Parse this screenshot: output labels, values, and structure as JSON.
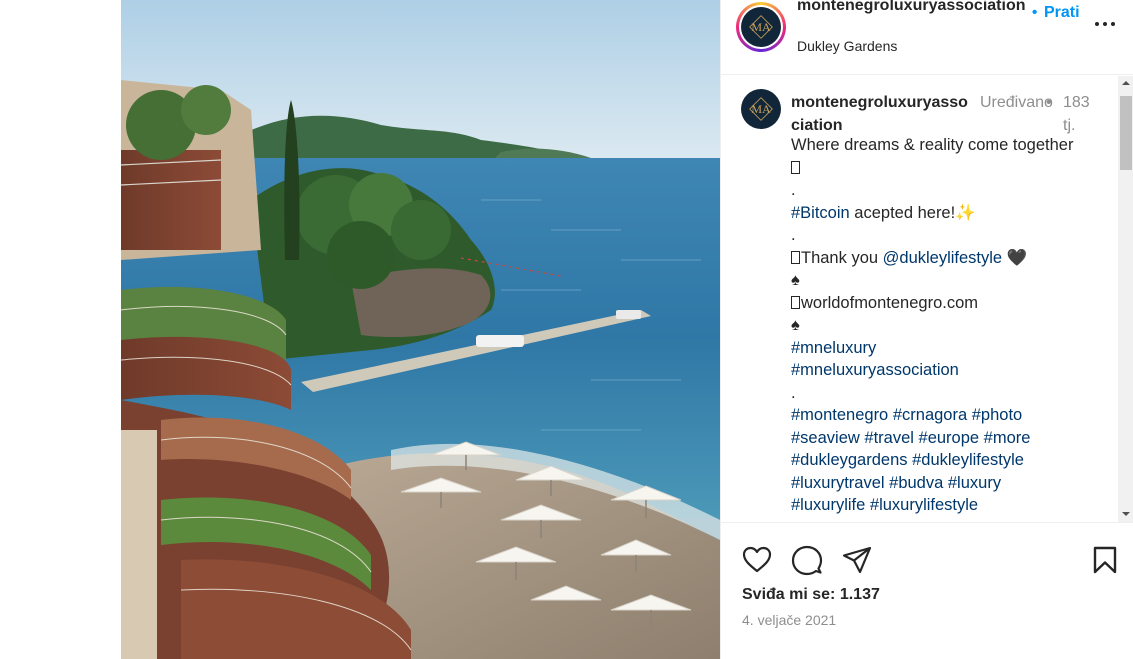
{
  "post": {
    "username_header": "montenegroluxuryassociation",
    "follow_dot": "•",
    "follow_label": "Prati",
    "location": "Dukley Gardens",
    "avatar_monogram": "MA"
  },
  "caption": {
    "username": "montenegroluxuryassociation",
    "edited_label": "Uređivano",
    "bullet": "•",
    "age": "183 tj.",
    "lines": [
      [
        {
          "t": "Where dreams & reality come together"
        }
      ],
      [
        {
          "t": "",
          "tofu": true
        }
      ],
      [
        {
          "t": "."
        }
      ],
      [
        {
          "t": "#Bitcoin",
          "tag": true
        },
        {
          "t": " acepted here!✨"
        }
      ],
      [
        {
          "t": "."
        }
      ],
      [
        {
          "t": "",
          "tofu": true
        },
        {
          "t": "Thank you "
        },
        {
          "t": "@dukleylifestyle",
          "tag": true
        },
        {
          "t": " 🖤"
        }
      ],
      [
        {
          "t": "♠"
        }
      ],
      [
        {
          "t": "",
          "tofu": true
        },
        {
          "t": "worldofmontenegro.com"
        }
      ],
      [
        {
          "t": "♠"
        }
      ],
      [
        {
          "t": "#mneluxury",
          "tag": true
        }
      ],
      [
        {
          "t": "#mneluxuryassociation",
          "tag": true
        }
      ],
      [
        {
          "t": "."
        }
      ],
      [
        {
          "t": "#montenegro",
          "tag": true
        },
        {
          "t": " "
        },
        {
          "t": "#crnagora",
          "tag": true
        },
        {
          "t": " "
        },
        {
          "t": "#photo",
          "tag": true
        }
      ],
      [
        {
          "t": "#seaview",
          "tag": true
        },
        {
          "t": " "
        },
        {
          "t": "#travel",
          "tag": true
        },
        {
          "t": " "
        },
        {
          "t": "#europe",
          "tag": true
        },
        {
          "t": " "
        },
        {
          "t": "#more",
          "tag": true
        }
      ],
      [
        {
          "t": "#dukleygardens",
          "tag": true
        },
        {
          "t": " "
        },
        {
          "t": "#dukleylifestyle",
          "tag": true
        }
      ],
      [
        {
          "t": "#luxurytravel",
          "tag": true
        },
        {
          "t": " "
        },
        {
          "t": "#budva",
          "tag": true
        },
        {
          "t": " "
        },
        {
          "t": "#luxury",
          "tag": true
        }
      ],
      [
        {
          "t": "#luxurylife",
          "tag": true
        },
        {
          "t": " "
        },
        {
          "t": "#luxurylifestyle",
          "tag": true
        }
      ]
    ]
  },
  "actions": {
    "like_icon": "heart-icon",
    "comment_icon": "comment-icon",
    "share_icon": "paper-plane-icon",
    "save_icon": "bookmark-icon"
  },
  "likes": "Sviđa mi se: 1.137",
  "date": "4. veljače 2021",
  "colors": {
    "link_blue": "#0095f6",
    "hashtag": "#00376b",
    "muted": "#8e8e8e",
    "text": "#262626",
    "avatar_bg": "#12263a",
    "monogram_gold": "#c9a45c"
  }
}
